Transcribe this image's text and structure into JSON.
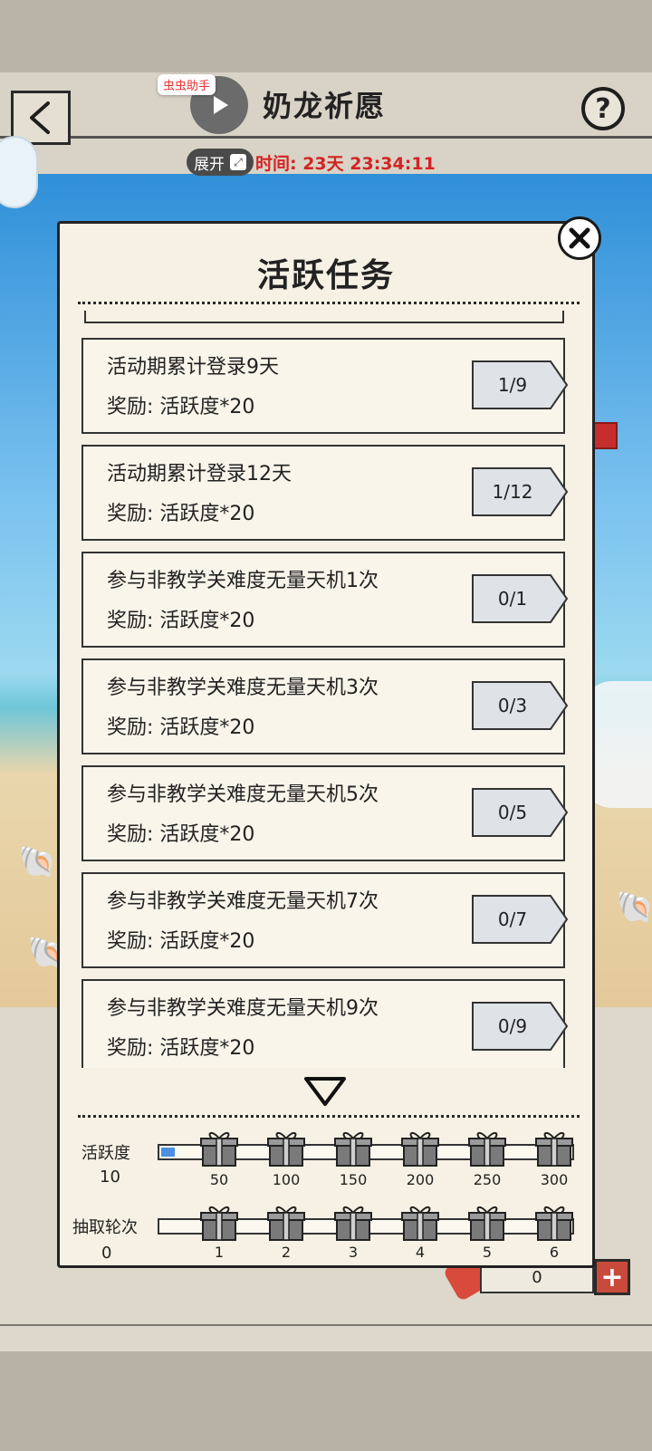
{
  "header": {
    "title": "奶龙祈愿",
    "assistant_badge": "虫虫助手",
    "expand_label": "展开",
    "timer_text": "时间: 23天 23:34:11",
    "help_label": "?"
  },
  "modal": {
    "title": "活跃任务",
    "tasks": [
      {
        "name": "活动期累计登录9天",
        "reward": "奖励: 活跃度*20",
        "progress": "1/9"
      },
      {
        "name": "活动期累计登录12天",
        "reward": "奖励: 活跃度*20",
        "progress": "1/12"
      },
      {
        "name": "参与非教学关难度无量天机1次",
        "reward": "奖励: 活跃度*20",
        "progress": "0/1"
      },
      {
        "name": "参与非教学关难度无量天机3次",
        "reward": "奖励: 活跃度*20",
        "progress": "0/3"
      },
      {
        "name": "参与非教学关难度无量天机5次",
        "reward": "奖励: 活跃度*20",
        "progress": "0/5"
      },
      {
        "name": "参与非教学关难度无量天机7次",
        "reward": "奖励: 活跃度*20",
        "progress": "0/7"
      },
      {
        "name": "参与非教学关难度无量天机9次",
        "reward": "奖励: 活跃度*20",
        "progress": "0/9"
      }
    ],
    "activity": {
      "label": "活跃度",
      "value": "10",
      "fill_fraction": 0.033,
      "milestones": [
        "50",
        "100",
        "150",
        "200",
        "250",
        "300"
      ]
    },
    "draws": {
      "label": "抽取轮次",
      "value": "0",
      "fill_fraction": 0,
      "milestones": [
        "1",
        "2",
        "3",
        "4",
        "5",
        "6"
      ]
    }
  },
  "footer": {
    "counter_value": "0",
    "plus_label": "+"
  },
  "colors": {
    "timer_red": "#d42323",
    "progress_blue": "#4a90e0",
    "tag_gray": "#dfe3e8"
  }
}
